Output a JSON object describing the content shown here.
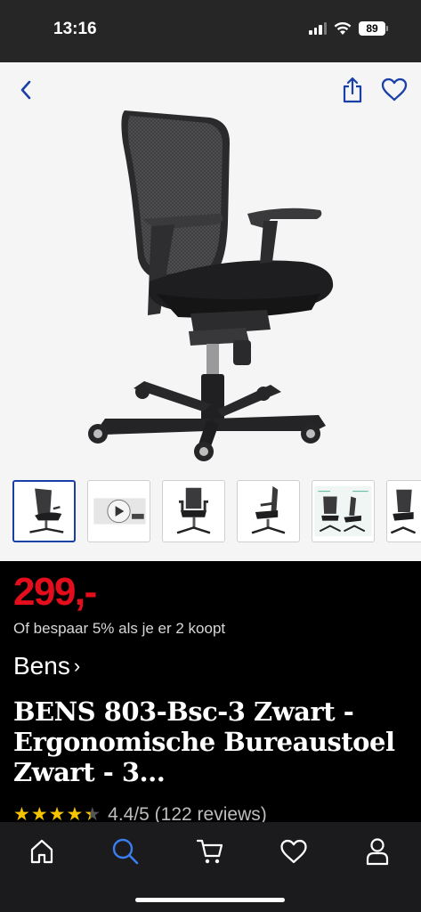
{
  "status_bar": {
    "time": "13:16",
    "battery": "89",
    "icons": [
      "signal-icon",
      "wifi-icon",
      "battery-icon"
    ]
  },
  "header": {
    "icons": [
      "back-chevron-icon",
      "share-icon",
      "heart-icon"
    ]
  },
  "gallery": {
    "thumbnail_count": 6,
    "active_index": 0,
    "video_thumbnail_index": 1
  },
  "product": {
    "price": "299,-",
    "promo": "Of bespaar 5% als je er 2 koopt",
    "brand": "Bens",
    "brand_chevron": "›",
    "title": "BENS 803-Bsc-3 Zwart - Ergonomische Bureaustoel Zwart - 3...",
    "rating": {
      "stars": 4.4,
      "text": "4.4/5 (122 reviews)"
    }
  },
  "bottom_nav": {
    "items": [
      "home-icon",
      "search-icon",
      "cart-icon",
      "heart-icon",
      "account-icon"
    ],
    "active": "search-icon"
  },
  "colors": {
    "price": "#e40d1c",
    "accent": "#1a3fa8",
    "active_nav": "#3b7ef2",
    "stars": "#f5c400"
  }
}
